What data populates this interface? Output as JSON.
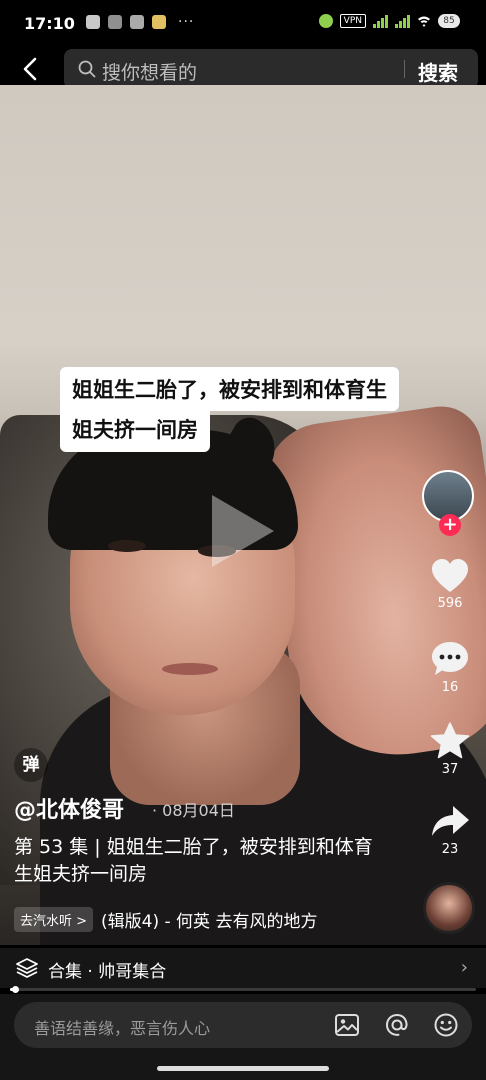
{
  "status_bar": {
    "time": "17:10",
    "dots": "···",
    "vpn_label": "VPN",
    "battery": "85"
  },
  "search": {
    "placeholder": "搜你想看的",
    "button_label": "搜索"
  },
  "video": {
    "caption_line1": "姐姐生二胎了，被安排到和体育生",
    "caption_line2": "姐夫挤一间房"
  },
  "actions": {
    "like_count": "596",
    "comment_count": "16",
    "favorite_count": "37",
    "share_count": "23",
    "follow_label": "+"
  },
  "info": {
    "danmu_label": "弹",
    "author": "@北体俊哥",
    "date": "· 08月04日",
    "description": "第 53 集 | 姐姐生二胎了，被安排到和体育生姐夫挤一间房",
    "qishui_label": "去汽水听 >",
    "music_text": "(辑版4) - 何英    去有风的地方"
  },
  "collection": {
    "label": "合集 · 帅哥集合",
    "arrow": "›"
  },
  "progress": {
    "fraction": 0.01
  },
  "comment": {
    "placeholder": "善语结善缘，恶言伤人心"
  },
  "colors": {
    "accent": "#fe2c55",
    "background": "#000000",
    "panel": "#161616"
  }
}
